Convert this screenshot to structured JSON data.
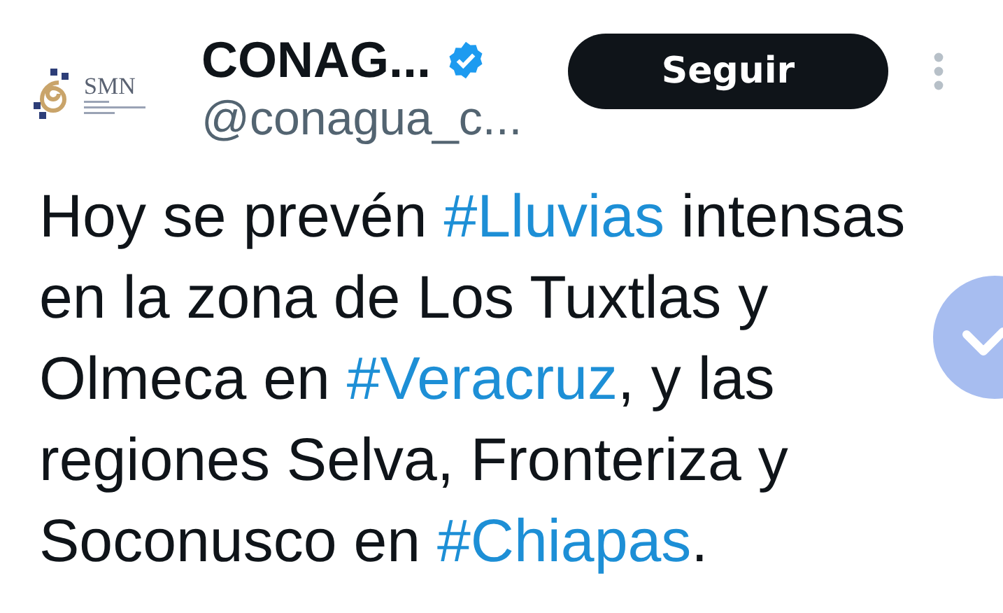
{
  "account": {
    "logo_text": "SMN",
    "name": "CONAG...",
    "verified": true,
    "handle": "@conagua_c..."
  },
  "follow_button": {
    "label": "Seguir"
  },
  "tweet": {
    "lines": [
      [
        {
          "kind": "text",
          "text": "Hoy se prevén "
        },
        {
          "kind": "hashtag",
          "text": "#Lluvias"
        },
        {
          "kind": "text",
          "text": " intensas"
        }
      ],
      [
        {
          "kind": "text",
          "text": "en la zona de Los Tuxtlas y"
        }
      ],
      [
        {
          "kind": "text",
          "text": "Olmeca en "
        },
        {
          "kind": "hashtag",
          "text": "#Veracruz"
        },
        {
          "kind": "text",
          "text": ", y las"
        }
      ],
      [
        {
          "kind": "text",
          "text": "regiones Selva, Fronteriza y"
        }
      ],
      [
        {
          "kind": "text",
          "text": "Soconusco en "
        },
        {
          "kind": "hashtag",
          "text": "#Chiapas"
        },
        {
          "kind": "text",
          "text": "."
        }
      ]
    ]
  }
}
